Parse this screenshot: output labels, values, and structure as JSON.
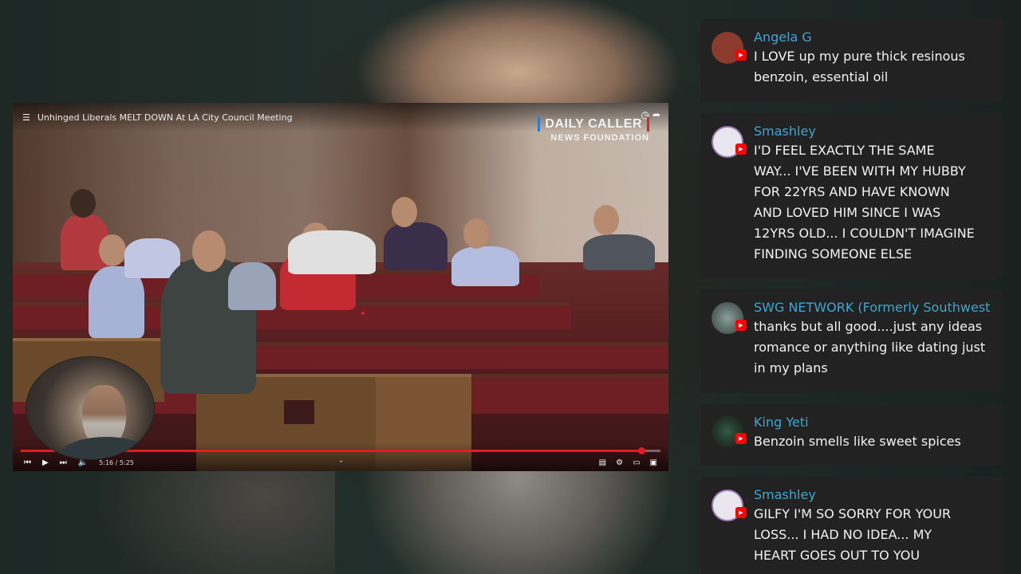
{
  "video": {
    "title": "Unhinged Liberals MELT DOWN At LA City Council Meeting",
    "brand_line1": "DAILY CALLER",
    "brand_line2": "NEWS FOUNDATION",
    "time_display": "5:16 / 5:25",
    "progress": 0.97
  },
  "chat": [
    {
      "author": "Angela G",
      "lines": [
        "I LOVE up my pure thick resinous",
        "benzoin, essential oil"
      ],
      "avatar_color": "#8a3b2e"
    },
    {
      "author": "Smashley",
      "lines": [
        "I'D FEEL EXACTLY THE SAME",
        "WAY... I'VE BEEN WITH MY HUBBY",
        "FOR 22YRS AND HAVE KNOWN",
        "AND LOVED HIM SINCE I WAS",
        "12YRS OLD... I COULDN'T IMAGINE",
        "FINDING SOMEONE ELSE"
      ],
      "avatar_color": "#e9e6f0"
    },
    {
      "author": "SWG NETWORK (Formerly Southwest",
      "lines": [
        "thanks but all good....just any ideas",
        "romance or anything like dating just",
        "in my plans"
      ],
      "avatar_color": "#4c5a56"
    },
    {
      "author": "King Yeti",
      "lines": [
        "Benzoin smells like sweet spices"
      ],
      "avatar_color": "#1f2a24"
    },
    {
      "author": "Smashley",
      "lines": [
        "GILFY I'M SO SORRY FOR YOUR",
        "LOSS... I HAD NO IDEA... MY",
        "HEART GOES OUT TO YOU"
      ],
      "avatar_color": "#e9e6f0"
    }
  ],
  "colors": {
    "author": "#3ea6cf",
    "chat_bg": "#222222",
    "progress": "#e41b23",
    "youtube_badge": "#ff0000"
  }
}
